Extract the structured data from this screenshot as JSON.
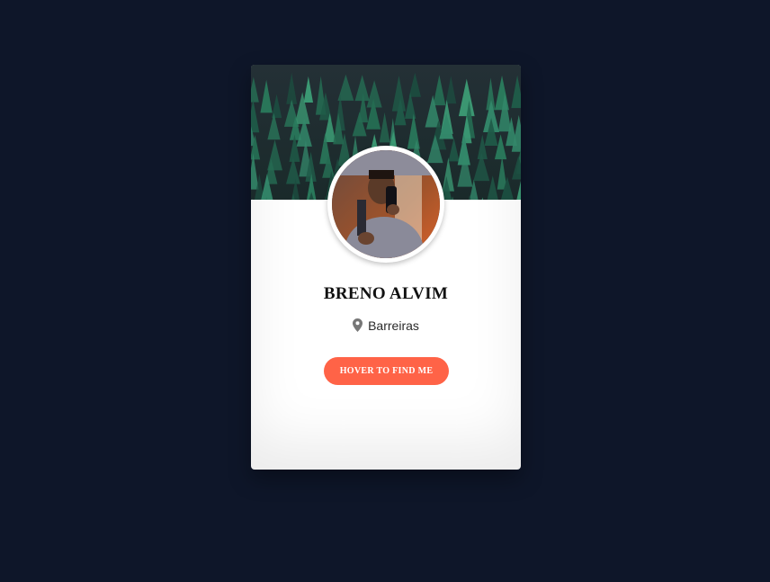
{
  "profile": {
    "name": "BRENO ALVIM",
    "location": "Barreiras",
    "button_label": "HOVER TO FIND ME"
  },
  "colors": {
    "page_background": "#0e1629",
    "card_background": "#ffffff",
    "button_background": "#ff6347",
    "button_text": "#ffffff"
  },
  "icons": {
    "location": "map-pin-icon"
  },
  "images": {
    "cover": "forest-cover-image",
    "avatar": "profile-photo"
  }
}
